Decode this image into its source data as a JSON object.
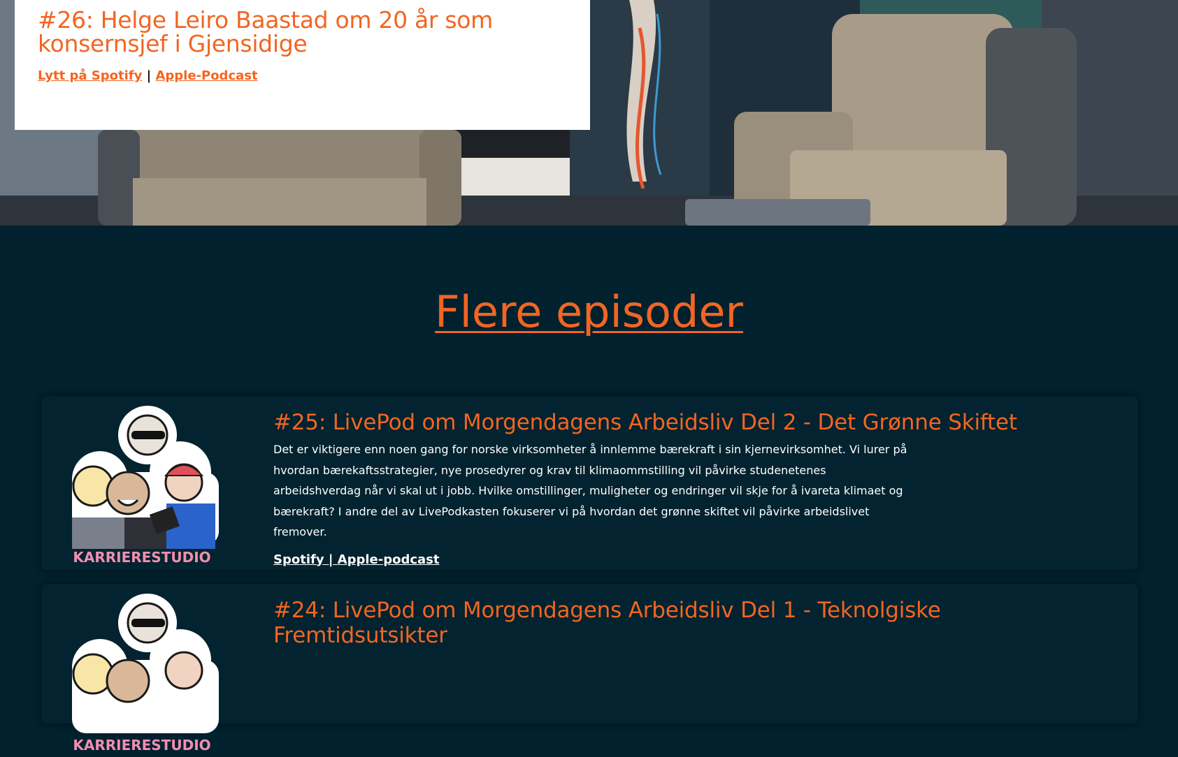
{
  "hero": {
    "title": "#26: Helge Leiro Baastad om 20 år som konsernsjef i Gjensidige",
    "links": [
      {
        "label": "Lytt på Spotify"
      },
      {
        "label": "Apple-Podcast"
      }
    ],
    "separator": "|"
  },
  "section": {
    "title": "Flere episoder"
  },
  "episodes": [
    {
      "title": "#25: LivePod om Morgendagens Arbeidsliv Del 2 - Det Grønne Skiftet",
      "description": "Det er viktigere enn noen gang for norske virksomheter å innlemme bærekraft i sin kjernevirksomhet. Vi lurer på hvordan bærekaftsstrategier, nye prosedyrer og krav til klimaommstilling vil påvirke studenetenes arbeidshverdag når vi skal ut i jobb. Hvilke omstillinger, muligheter og endringer vil skje for å ivareta klimaet og bærekraft? I andre del av LivePodkasten fokuserer vi på hvordan det grønne skiftet vil påvirke arbeidslivet fremover.",
      "links": [
        {
          "label": "Spotify"
        },
        {
          "label": "Apple-podcast"
        }
      ],
      "separator": " | ",
      "logo_text": "KARRIERESTUDIO"
    },
    {
      "title": "#24: LivePod om Morgendagens Arbeidsliv Del 1 - Teknolgiske Fremtidsutsikter",
      "logo_text": "KARRIERESTUDIO"
    }
  ],
  "colors": {
    "accent": "#f26522",
    "background": "#01212e",
    "card": "#02232f",
    "text": "#ffffff",
    "logo_pink": "#f08fb0"
  }
}
